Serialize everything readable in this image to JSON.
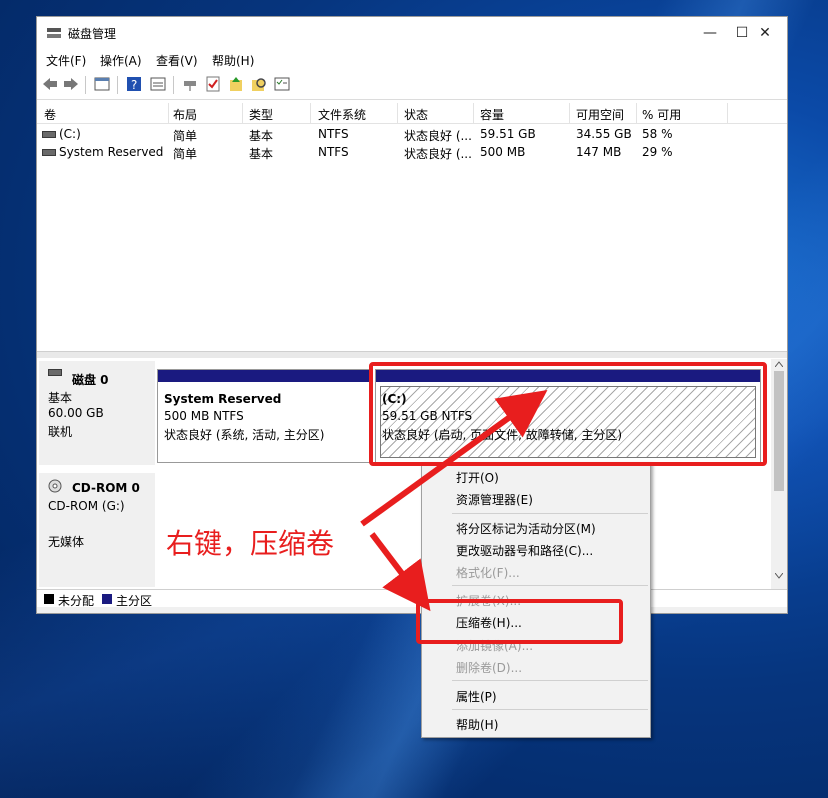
{
  "window": {
    "title": "磁盘管理",
    "controls": {
      "minimize": "—",
      "maximize": "☐",
      "close": "✕"
    }
  },
  "menu": [
    "文件(F)",
    "操作(A)",
    "查看(V)",
    "帮助(H)"
  ],
  "toolbar": [
    "back-icon",
    "forward-icon",
    "console-icon",
    "help-icon",
    "properties-icon",
    "connect-icon",
    "check-icon",
    "up-icon",
    "search-icon",
    "list-icon"
  ],
  "table": {
    "headers": [
      "卷",
      "布局",
      "类型",
      "文件系统",
      "状态",
      "容量",
      "可用空间",
      "% 可用"
    ],
    "rows": [
      [
        "(C:)",
        "简单",
        "基本",
        "NTFS",
        "状态良好 (...",
        "59.51 GB",
        "34.55 GB",
        "58 %"
      ],
      [
        "System Reserved",
        "简单",
        "基本",
        "NTFS",
        "状态良好 (...",
        "500 MB",
        "147 MB",
        "29 %"
      ]
    ]
  },
  "disks": [
    {
      "name": "磁盘 0",
      "type": "基本",
      "size": "60.00 GB",
      "status": "联机"
    },
    {
      "name": "CD-ROM 0",
      "type": "CD-ROM (G:)",
      "status": "无媒体"
    }
  ],
  "volumes": [
    {
      "name": "System Reserved",
      "size": "500 MB NTFS",
      "status": "状态良好 (系统, 活动, 主分区)"
    },
    {
      "name": "(C:)",
      "size": "59.51 GB NTFS",
      "status": "状态良好 (启动, 页面文件, 故障转储, 主分区)"
    }
  ],
  "legend": {
    "unallocated": "未分配",
    "primary": "主分区",
    "colors": {
      "unallocated": "#000000",
      "primary": "#1a1a80"
    }
  },
  "context_menu": [
    {
      "label": "打开(O)",
      "enabled": true
    },
    {
      "label": "资源管理器(E)",
      "enabled": true
    },
    {
      "label": "将分区标记为活动分区(M)",
      "enabled": true
    },
    {
      "label": "更改驱动器号和路径(C)...",
      "enabled": true
    },
    {
      "label": "格式化(F)...",
      "enabled": false
    },
    {
      "label": "扩展卷(X)...",
      "enabled": false
    },
    {
      "label": "压缩卷(H)...",
      "enabled": true
    },
    {
      "label": "添加镜像(A)...",
      "enabled": false
    },
    {
      "label": "删除卷(D)...",
      "enabled": false
    },
    {
      "label": "属性(P)",
      "enabled": true
    },
    {
      "label": "帮助(H)",
      "enabled": true
    }
  ],
  "annotation": {
    "text": "右键，压缩卷",
    "color": "#e81e1e"
  }
}
